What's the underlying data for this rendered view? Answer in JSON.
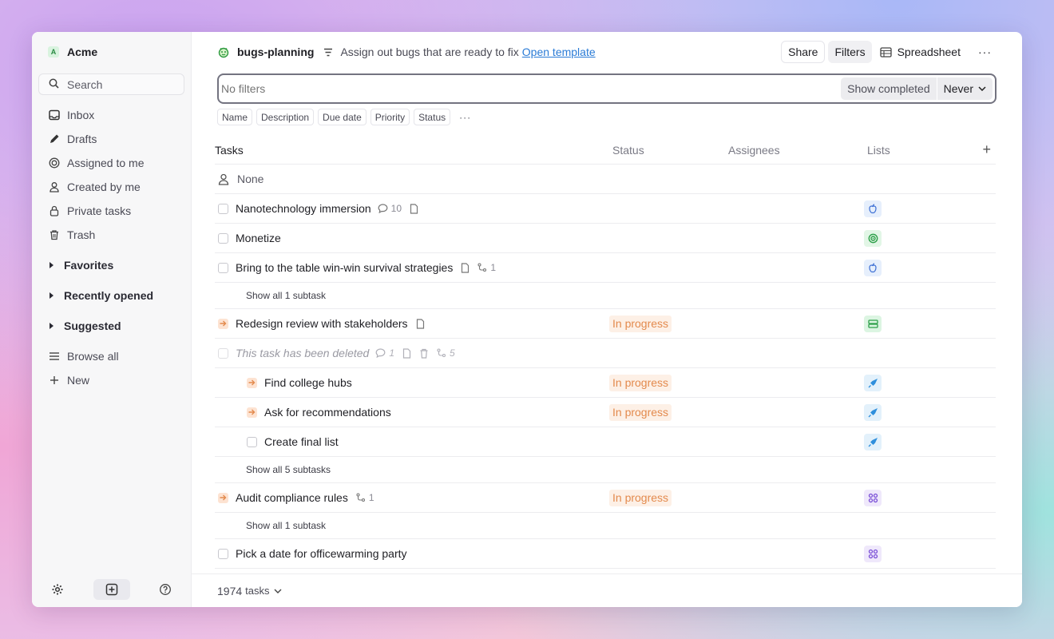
{
  "workspace": {
    "badge": "A",
    "name": "Acme"
  },
  "sidebar": {
    "search_label": "Search",
    "items": [
      {
        "label": "Inbox",
        "icon": "inbox-icon"
      },
      {
        "label": "Drafts",
        "icon": "pencil-icon"
      },
      {
        "label": "Assigned to me",
        "icon": "target-icon"
      },
      {
        "label": "Created by me",
        "icon": "user-icon"
      },
      {
        "label": "Private tasks",
        "icon": "lock-icon"
      },
      {
        "label": "Trash",
        "icon": "trash-icon"
      }
    ],
    "sections": [
      "Favorites",
      "Recently opened",
      "Suggested"
    ],
    "browse_all": "Browse all",
    "new": "New"
  },
  "header": {
    "project_name": "bugs-planning",
    "description": "Assign out bugs that are ready to fix",
    "template_link": "Open template",
    "share": "Share",
    "filters": "Filters",
    "view": "Spreadsheet",
    "more": "···"
  },
  "filter": {
    "placeholder": "No filters",
    "show_completed": "Show completed",
    "never": "Never"
  },
  "columns_chips": [
    "Name",
    "Description",
    "Due date",
    "Priority",
    "Status"
  ],
  "chips_more": "···",
  "table": {
    "headers": {
      "tasks": "Tasks",
      "status": "Status",
      "assignees": "Assignees",
      "lists": "Lists",
      "add": "+"
    },
    "group": "None",
    "rows": {
      "r1": {
        "name": "Nanotechnology immersion",
        "comments": "10"
      },
      "r2": {
        "name": "Monetize"
      },
      "r3": {
        "name": "Bring to the table win-win survival strategies",
        "subtasks": "1",
        "show_sub": "Show all 1 subtask"
      },
      "r4": {
        "name": "Redesign review with stakeholders",
        "status": "In progress"
      },
      "r5": {
        "name": "This task has been deleted",
        "comments": "1",
        "subtasks": "5"
      },
      "r6": {
        "name": "Find college hubs",
        "status": "In progress"
      },
      "r7": {
        "name": "Ask for recommendations",
        "status": "In progress"
      },
      "r8": {
        "name": "Create final list",
        "show_sub": "Show all 5 subtasks"
      },
      "r9": {
        "name": "Audit compliance rules",
        "status": "In progress",
        "subtasks": "1",
        "show_sub": "Show all 1 subtask"
      },
      "r10": {
        "name": "Pick a date for officewarming party"
      }
    }
  },
  "footer": {
    "count": "1974",
    "unit": "tasks"
  },
  "colors": {
    "accent_link": "#2a7bd6",
    "in_progress": "#e38a4d",
    "in_progress_bg": "#fdf0e6"
  }
}
